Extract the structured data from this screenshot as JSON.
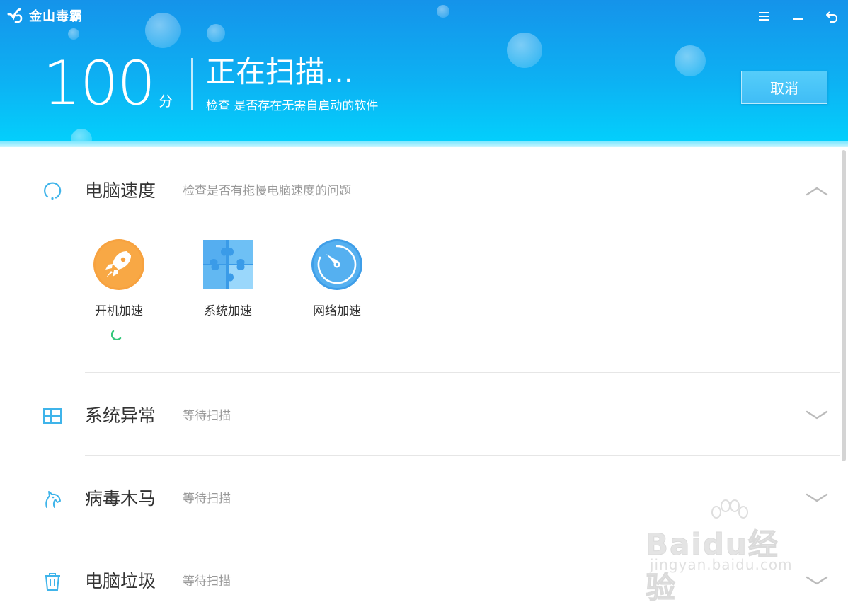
{
  "app": {
    "brand": "金山毒霸"
  },
  "header": {
    "score": "100",
    "score_unit": "分",
    "status_title": "正在扫描...",
    "status_sub": "检查 是否存在无需自启动的软件",
    "cancel_label": "取消"
  },
  "sections": [
    {
      "title": "电脑速度",
      "desc": "检查是否有拖慢电脑速度的问题",
      "icon": "circle-arc-icon",
      "expanded": true
    },
    {
      "title": "系统异常",
      "desc": "等待扫描",
      "icon": "windows-icon",
      "expanded": false
    },
    {
      "title": "病毒木马",
      "desc": "等待扫描",
      "icon": "horse-icon",
      "expanded": false
    },
    {
      "title": "电脑垃圾",
      "desc": "等待扫描",
      "icon": "trash-icon",
      "expanded": false
    }
  ],
  "speed_items": [
    {
      "label": "开机加速",
      "icon": "rocket-icon"
    },
    {
      "label": "系统加速",
      "icon": "puzzle-icon"
    },
    {
      "label": "网络加速",
      "icon": "speedometer-icon"
    }
  ],
  "watermark": {
    "text": "Baidu经验",
    "url": "jingyan.baidu.com"
  },
  "colors": {
    "header_top": "#1593ea",
    "header_bottom": "#02d2fd",
    "accent": "#3fb4ea",
    "rocket": "#f7a23f"
  }
}
